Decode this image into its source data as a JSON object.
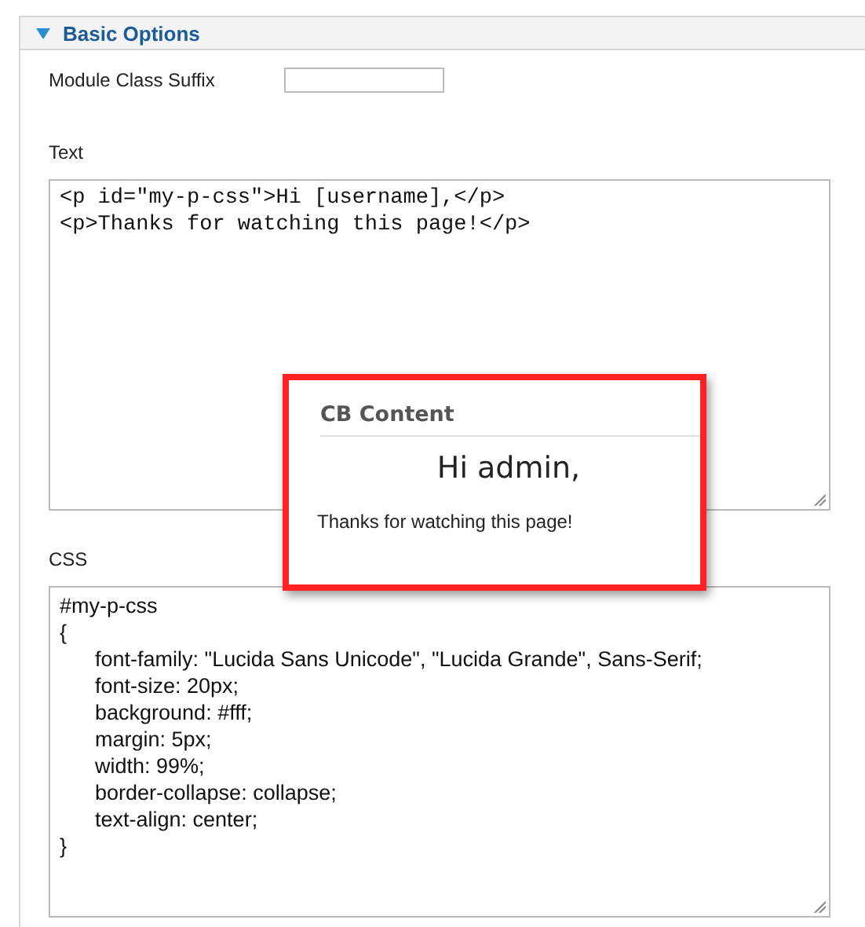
{
  "panel": {
    "title": "Basic Options",
    "expanded": true
  },
  "fields": [
    {
      "kind": "input",
      "label": "Module Class Suffix"
    },
    {
      "kind": "code",
      "label": "Text",
      "value": "<p id=\"my-p-css\">Hi [username],</p>\n<p>Thanks for watching this page!</p>"
    },
    {
      "kind": "prose",
      "label": "CSS",
      "value": "#my-p-css\n{\n\tfont-family: \"Lucida Sans Unicode\", \"Lucida Grande\", Sans-Serif;\n\tfont-size: 20px;\n\tbackground: #fff;\n\tmargin: 5px;\n\twidth: 99%;\n\tborder-collapse: collapse;\n\ttext-align: center;\n}"
    }
  ],
  "preview": {
    "title": "CB Content",
    "heading": "Hi admin,",
    "text": "Thanks for watching this page!"
  }
}
